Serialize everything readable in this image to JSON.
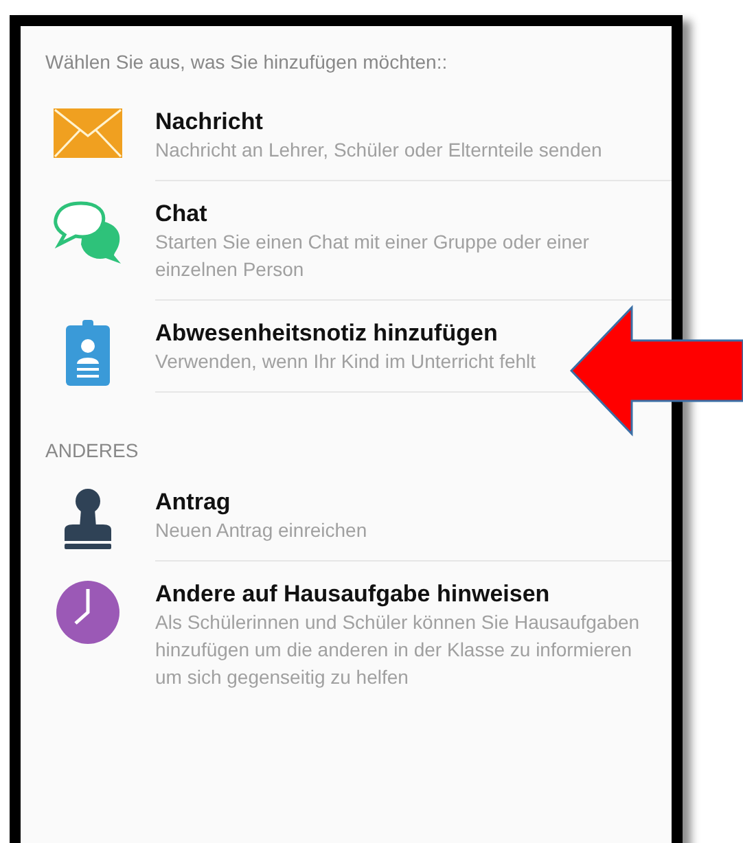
{
  "header": "Wählen Sie aus, was Sie hinzufügen möchten::",
  "sections": [
    {
      "items": [
        {
          "kind": "envelope",
          "title": "Nachricht",
          "subtitle": "Nachricht an Lehrer, Schüler oder Elternteile senden"
        },
        {
          "kind": "chat",
          "title": "Chat",
          "subtitle": "Starten Sie einen Chat mit einer Gruppe oder einer einzelnen Person"
        },
        {
          "kind": "badge",
          "title": "Abwesenheitsnotiz hinzufügen",
          "subtitle": "Verwenden, wenn Ihr Kind im Unterricht fehlt"
        }
      ]
    },
    {
      "title": "ANDERES",
      "items": [
        {
          "kind": "stamp",
          "title": "Antrag",
          "subtitle": "Neuen Antrag einreichen"
        },
        {
          "kind": "clock",
          "title": "Andere auf Hausaufgabe hinweisen",
          "subtitle": "Als Schülerinnen und Schüler können Sie Hausaufgaben hinzufügen um die anderen in der Klasse zu informieren um sich gegenseitig zu helfen"
        }
      ]
    }
  ],
  "annotation": {
    "kind": "arrow"
  }
}
